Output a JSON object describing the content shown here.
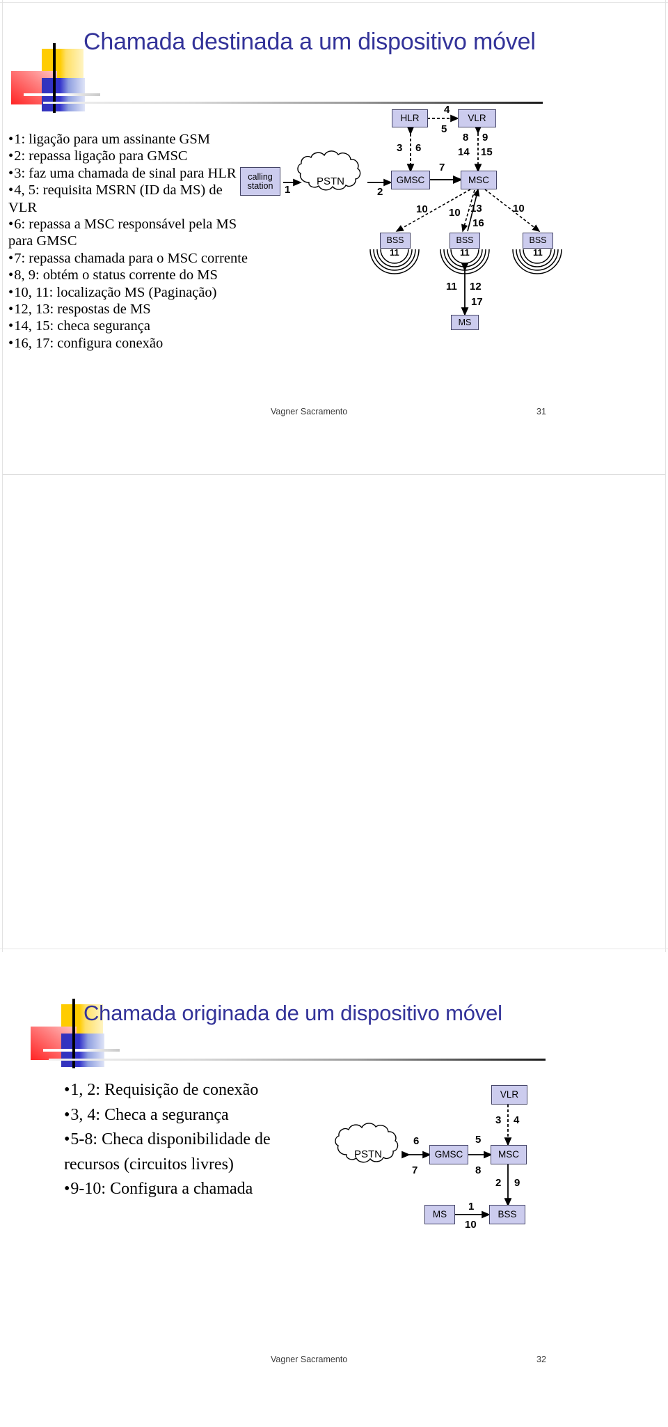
{
  "document": {
    "slides": [
      {
        "id": "slide-31",
        "title": "Chamada destinada a um dispositivo móvel",
        "bullets": [
          "1: ligação para um assinante GSM",
          "2: repassa ligação para GMSC",
          "3: faz uma chamada de sinal para HLR",
          "4, 5: requisita MSRN (ID da MS) de VLR",
          "6: repassa a MSC responsável pela MS para GMSC",
          "7: repassa chamada para o MSC corrente",
          "8, 9: obtém o status corrente do MS",
          "10, 11: localização MS (Paginação)",
          "12, 13: respostas de MS",
          "14, 15: checa segurança",
          "16, 17: configura conexão"
        ],
        "footer": {
          "author": "Vagner Sacramento",
          "page": "31"
        },
        "diagram": {
          "nodes": {
            "calling_station": "calling station",
            "pstn": "PSTN",
            "gmsc": "GMSC",
            "msc": "MSC",
            "hlr": "HLR",
            "vlr": "VLR",
            "bss_left": "BSS",
            "bss_mid": "BSS",
            "bss_right": "BSS",
            "ms": "MS"
          },
          "labels": {
            "calling_to_pstn": "1",
            "pstn_to_gmsc": "2",
            "hlr_gmsc_down": "3",
            "hlr_gmsc_up": "6",
            "hlr_vlr_right": "4",
            "hlr_vlr_left": "5",
            "vlr_msc_a": "8",
            "vlr_msc_b": "9",
            "vlr_msc_c": "14",
            "vlr_msc_d": "15",
            "gmsc_to_msc": "7",
            "msc_bss_left": "10",
            "msc_bss_mid": "10",
            "msc_bss_right": "10",
            "bss_msc_up_a": "13",
            "bss_msc_up_b": "16",
            "bss_radio_left": "11",
            "bss_radio_mid": "11",
            "bss_radio_right": "11",
            "ms_bss_a": "11",
            "ms_bss_b": "12",
            "ms_bss_c": "17"
          }
        }
      },
      {
        "id": "slide-32",
        "title": "Chamada originada de um dispositivo móvel",
        "bullets": [
          "1, 2: Requisição de conexão",
          "3, 4: Checa a segurança",
          "5-8: Checa disponibilidade de recursos (circuitos livres)",
          "9-10: Configura a chamada"
        ],
        "footer": {
          "author": "Vagner Sacramento",
          "page": "32"
        },
        "diagram": {
          "nodes": {
            "pstn": "PSTN",
            "gmsc": "GMSC",
            "msc": "MSC",
            "vlr": "VLR",
            "bss": "BSS",
            "ms": "MS"
          },
          "labels": {
            "msc_vlr_up": "3",
            "msc_vlr_down": "4",
            "pstn_gmsc_top": "6",
            "pstn_gmsc_bottom": "7",
            "gmsc_msc_top": "5",
            "gmsc_msc_bottom": "8",
            "msc_bss_left": "2",
            "msc_bss_right": "9",
            "ms_bss_top": "1",
            "ms_bss_bottom": "10"
          }
        }
      }
    ],
    "theme": {
      "title_color": "#333399",
      "node_fill": "#ccccee",
      "node_stroke": "#444466",
      "logo_yellow": "#ffcc00",
      "logo_red": "#ff2424",
      "logo_blue": "#3333cc"
    }
  }
}
